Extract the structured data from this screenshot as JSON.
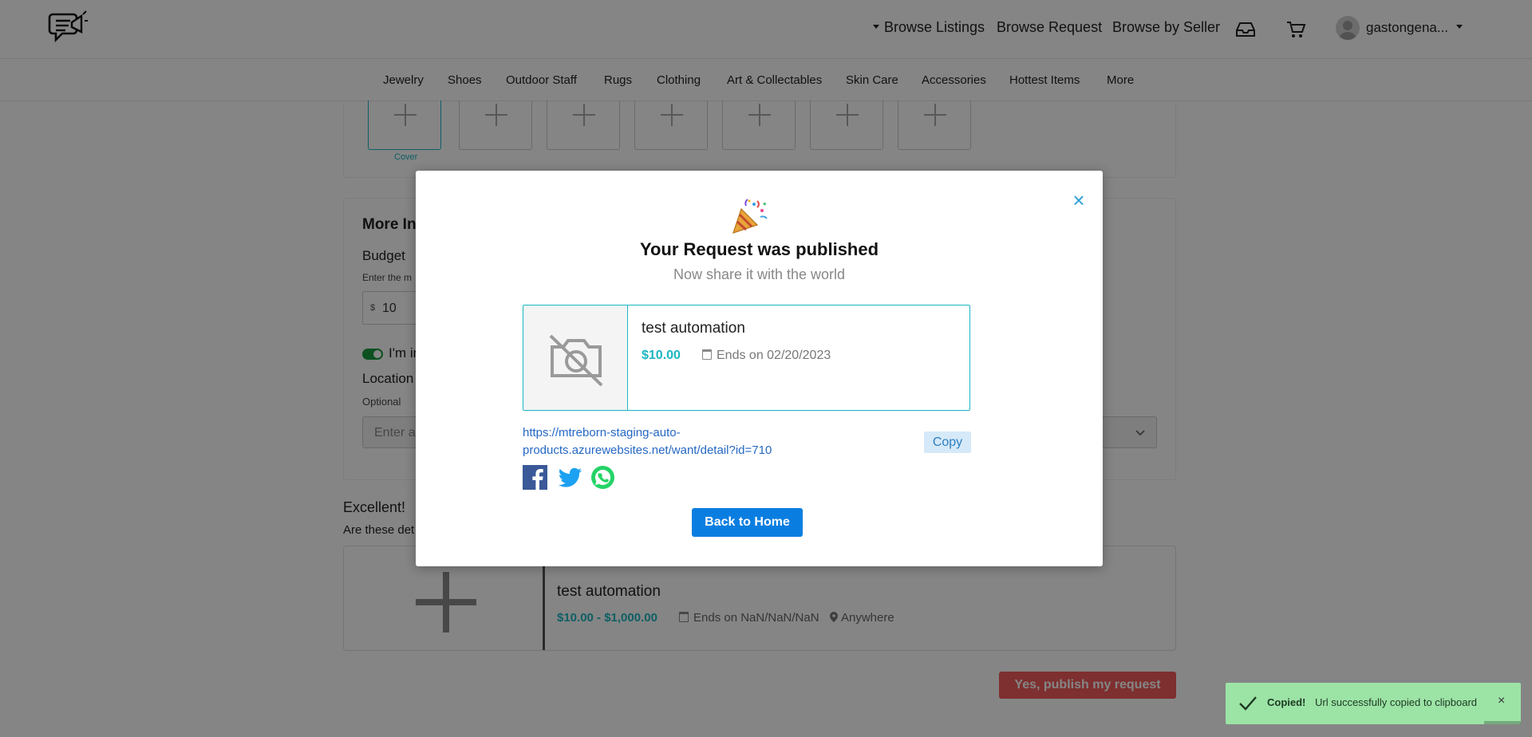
{
  "header": {
    "nav": {
      "browse_listings": "Browse Listings",
      "browse_request": "Browse Request",
      "browse_by_seller": "Browse by Seller"
    },
    "username": "gastongena...",
    "icons": [
      "logo-megaphone-chat-icon",
      "inbox-icon",
      "cart-icon",
      "avatar-icon",
      "caret-down-icon"
    ]
  },
  "categories": [
    "Jewelry",
    "Shoes",
    "Outdoor Staff",
    "Rugs",
    "Clothing",
    "Art & Collectables",
    "Skin Care",
    "Accessories",
    "Hottest Items",
    "More"
  ],
  "form": {
    "cover_label": "Cover",
    "more_info_title": "More In",
    "budget_label": "Budget",
    "budget_hint": "Enter the m",
    "currency": "$",
    "budget_value": "10",
    "toggle_label": "I'm in",
    "location_label": "Location",
    "location_optional": "Optional",
    "location_placeholder": "Enter a"
  },
  "preview": {
    "heading": "Excellent!",
    "subheading": "Are these det",
    "title": "test automation",
    "price_range": "$10.00 - $1,000.00",
    "ends": "Ends on NaN/NaN/NaN",
    "location": "Anywhere",
    "publish_label": "Yes, publish my request"
  },
  "modal": {
    "title": "Your Request was published",
    "subtitle": "Now share it with the world",
    "card": {
      "title": "test automation",
      "price": "$10.00",
      "ends": "Ends on 02/20/2023"
    },
    "url": "https://mtreborn-staging-auto-products.azurewebsites.net/want/detail?id=710",
    "copy_label": "Copy",
    "home_label": "Back to Home",
    "close_glyph": "×"
  },
  "toast": {
    "title": "Copied!",
    "message": "Url successfully copied to clipboard",
    "close_glyph": "×"
  },
  "colors": {
    "accent": "#1bb6c1",
    "primary_button": "#0a7ee0",
    "publish_button": "#f15a5a",
    "toast_bg": "#9ce3a6",
    "link": "#2568c4"
  }
}
